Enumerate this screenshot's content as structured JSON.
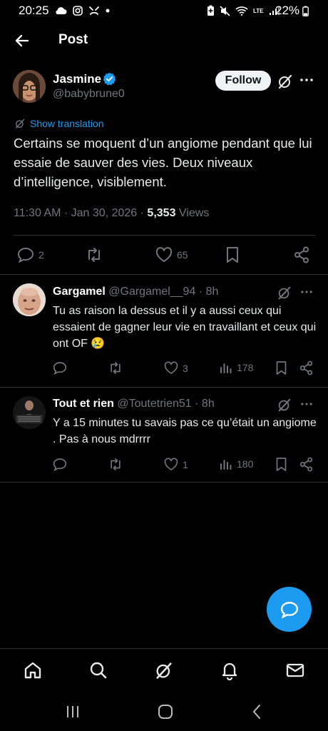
{
  "status_bar": {
    "time": "20:25",
    "battery": "22%",
    "network_label": "LTE"
  },
  "header": {
    "title": "Post"
  },
  "post": {
    "author_name": "Jasmine",
    "author_handle": "@babybrune0",
    "follow_label": "Follow",
    "show_translation": "Show translation",
    "text": "Certains se moquent d’un angiome pendant que lui essaie de sauver des vies. Deux niveaux d’intelligence, visiblement.",
    "time": "11:30 AM",
    "date": "Jan 30, 2026",
    "views_count": "5,353",
    "views_label": "Views",
    "replies": "2",
    "likes": "65"
  },
  "replies": [
    {
      "name": "Gargamel",
      "handle": "@Gargamel__94",
      "time": "8h",
      "text": "Tu as raison la dessus et il y a aussi ceux qui essaient de gagner leur vie en travaillant et ceux qui ont OF",
      "emoji": "😢",
      "likes": "3",
      "views": "178"
    },
    {
      "name": "Tout et rien",
      "handle": "@Toutetrien51",
      "time": "8h",
      "text": "Y a 15 minutes tu savais pas ce qu’était un angiome . Pas à nous mdrrrr",
      "likes": "1",
      "views": "180"
    }
  ],
  "colors": {
    "accent": "#1d9bf0",
    "background": "#000000",
    "secondary_text": "#71767b",
    "divider": "#2f3336"
  },
  "icons": {
    "back": "arrow-left-icon",
    "verified": "verified-badge-icon",
    "grok": "grok-icon",
    "more": "more-horizontal-icon",
    "reply": "reply-icon",
    "retweet": "retweet-icon",
    "like": "heart-icon",
    "views": "analytics-icon",
    "bookmark": "bookmark-icon",
    "share": "share-icon",
    "fab": "compose-reply-icon",
    "nav": [
      "home-icon",
      "search-icon",
      "grok-icon",
      "notifications-icon",
      "messages-icon"
    ]
  }
}
